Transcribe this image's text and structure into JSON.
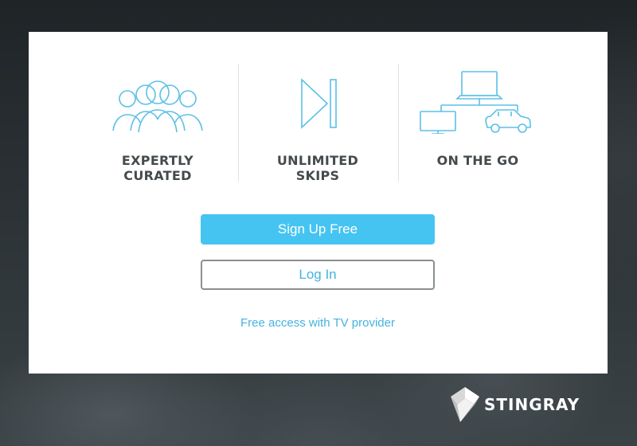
{
  "features": [
    {
      "icon": "audience-icon",
      "label_line1": "EXPERTLY",
      "label_line2": "CURATED"
    },
    {
      "icon": "skip-forward-icon",
      "label_line1": "UNLIMITED",
      "label_line2": "SKIPS"
    },
    {
      "icon": "multi-device-icon",
      "label_line1": "ON THE GO",
      "label_line2": ""
    }
  ],
  "actions": {
    "signup_label": "Sign Up Free",
    "login_label": "Log In",
    "tv_provider_link": "Free access with TV provider"
  },
  "brand": {
    "name": "STINGRAY"
  },
  "colors": {
    "accent": "#45c4f2",
    "link": "#45b3e0",
    "icon_stroke": "#5bc0e6",
    "label_text": "#444a4d"
  }
}
